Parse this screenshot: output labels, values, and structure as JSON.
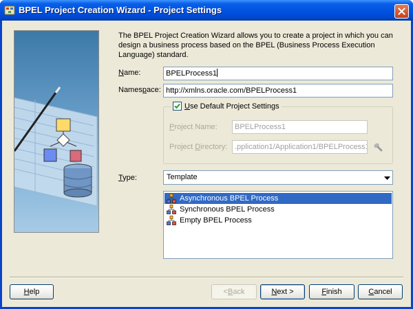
{
  "window": {
    "title": "BPEL Project Creation Wizard - Project Settings"
  },
  "description": "The BPEL Project Creation Wizard allows you to create a project in which you can design a business process based on the BPEL (Business Process Execution Language) standard.",
  "form": {
    "name_label_pre": "",
    "name_label_ul": "N",
    "name_label_post": "ame:",
    "name_value": "BPELProcess1",
    "namespace_label_pre": "Names",
    "namespace_label_ul": "p",
    "namespace_label_post": "ace:",
    "namespace_value": "http://xmlns.oracle.com/BPELProcess1"
  },
  "defaults_group": {
    "checkbox_checked": true,
    "checkbox_label_pre": "",
    "checkbox_label_ul": "U",
    "checkbox_label_post": "se Default Project Settings",
    "project_name_label_pre": "",
    "project_name_label_ul": "P",
    "project_name_label_post": "roject Name:",
    "project_name_value": "BPELProcess1",
    "project_dir_label_pre": "Project ",
    "project_dir_label_ul": "D",
    "project_dir_label_post": "irectory:",
    "project_dir_value": ".pplication1/Application1/BPELProcess1/"
  },
  "type": {
    "label_pre": "",
    "label_ul": "T",
    "label_post": "ype:",
    "selected": "Template",
    "templates": [
      {
        "label": "Asynchronous BPEL Process",
        "selected": true
      },
      {
        "label": "Synchronous BPEL Process",
        "selected": false
      },
      {
        "label": "Empty BPEL Process",
        "selected": false
      }
    ]
  },
  "buttons": {
    "help_ul": "H",
    "help_post": "elp",
    "back_pre": "< ",
    "back_ul": "B",
    "back_post": "ack",
    "next_ul": "N",
    "next_post": "ext >",
    "finish_ul": "F",
    "finish_post": "inish",
    "cancel_pre": "",
    "cancel_ul": "C",
    "cancel_post": "ancel"
  },
  "colors": {
    "titlebar": "#0054e3",
    "selection": "#316ac5",
    "dialog_bg": "#ece9d8"
  }
}
